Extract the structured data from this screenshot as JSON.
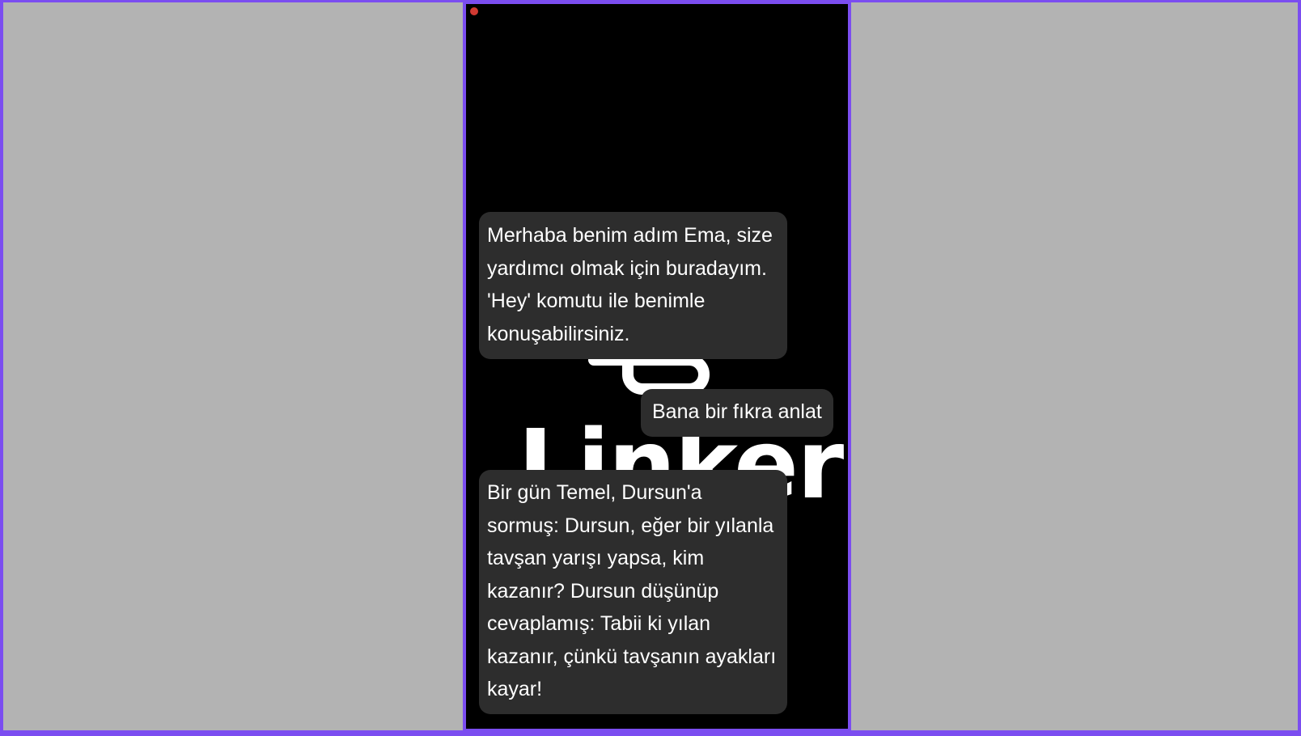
{
  "app": {
    "logo_text": "Linker",
    "logo_icon": "paperclip-link-icon",
    "recording_indicator": "recording-dot-icon"
  },
  "colors": {
    "frame": "#7b4df0",
    "background": "#b3b3b3",
    "screen": "#000000",
    "bubble": "#2d2d2d",
    "text": "#ffffff",
    "recording": "#d13a32"
  },
  "chat": {
    "messages": [
      {
        "sender": "assistant",
        "text": "Merhaba benim adım Ema, size yardımcı olmak için buradayım. 'Hey' komutu ile benimle konuşabilirsiniz."
      },
      {
        "sender": "user",
        "text": "Bana bir fıkra anlat"
      },
      {
        "sender": "assistant",
        "text": "Bir gün Temel, Dursun'a sormuş: Dursun, eğer bir yılanla tavşan yarışı yapsa, kim kazanır? Dursun düşünüp cevaplamış: Tabii ki yılan kazanır, çünkü tavşanın ayakları kayar!"
      }
    ]
  }
}
